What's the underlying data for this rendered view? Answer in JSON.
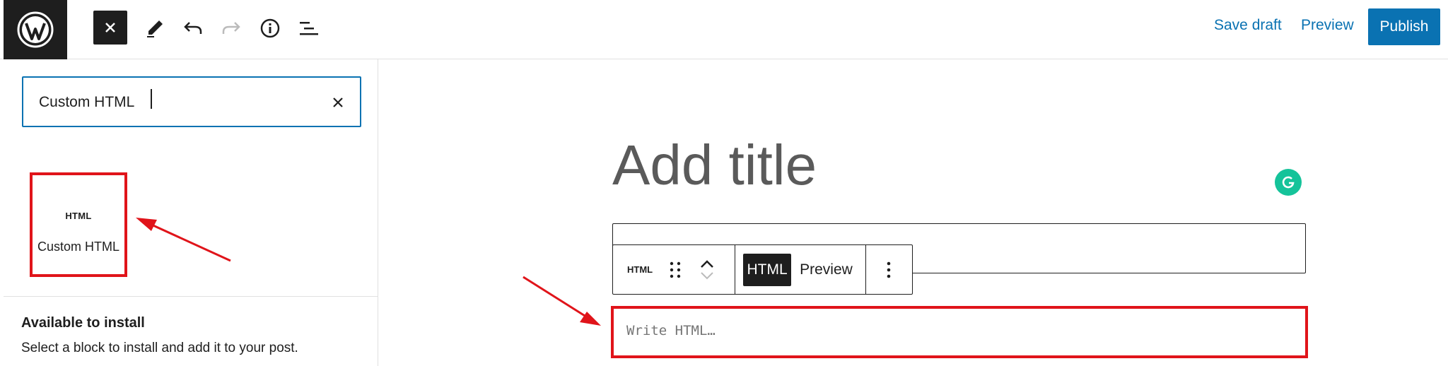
{
  "header": {
    "logo_icon": "wordpress-logo-icon",
    "tools": [
      {
        "icon": "close-icon",
        "active": true
      },
      {
        "icon": "pencil-icon"
      },
      {
        "icon": "undo-icon"
      },
      {
        "icon": "redo-icon",
        "disabled": true
      },
      {
        "icon": "info-icon"
      },
      {
        "icon": "list-view-icon"
      }
    ],
    "save_draft_label": "Save draft",
    "preview_label": "Preview",
    "publish_label": "Publish"
  },
  "inserter": {
    "search_value": "Custom HTML",
    "results": [
      {
        "icon_label": "HTML",
        "label": "Custom HTML"
      }
    ],
    "available_title": "Available to install",
    "available_desc": "Select a block to install and add it to your post."
  },
  "editor": {
    "title_placeholder": "Add title",
    "block_toolbar": {
      "block_icon_label": "HTML",
      "tab_html_label": "HTML",
      "tab_preview_label": "Preview"
    },
    "html_placeholder": "Write HTML…"
  },
  "colors": {
    "accent": "#0a72b2",
    "dark": "#1e1e1e",
    "annotation": "#e0141a",
    "grammarly": "#15c39a"
  }
}
